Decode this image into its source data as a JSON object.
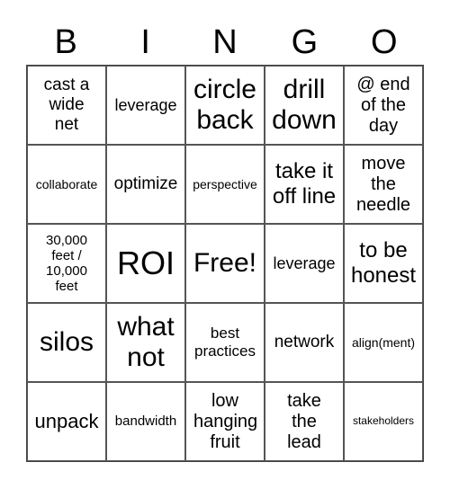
{
  "header": [
    "B",
    "I",
    "N",
    "G",
    "O"
  ],
  "cells": [
    "cast a wide net",
    "leverage",
    "circle back",
    "drill down",
    "@ end of the day",
    "collaborate",
    "optimize",
    "perspective",
    "take it off line",
    "move the needle",
    "30,000 feet / 10,000 feet",
    "ROI",
    "Free!",
    "leverage",
    "to be honest",
    "silos",
    "what not",
    "best practices",
    "network",
    "align(ment)",
    "unpack",
    "bandwidth",
    "low hanging fruit",
    "take the lead",
    "stakeholders"
  ]
}
